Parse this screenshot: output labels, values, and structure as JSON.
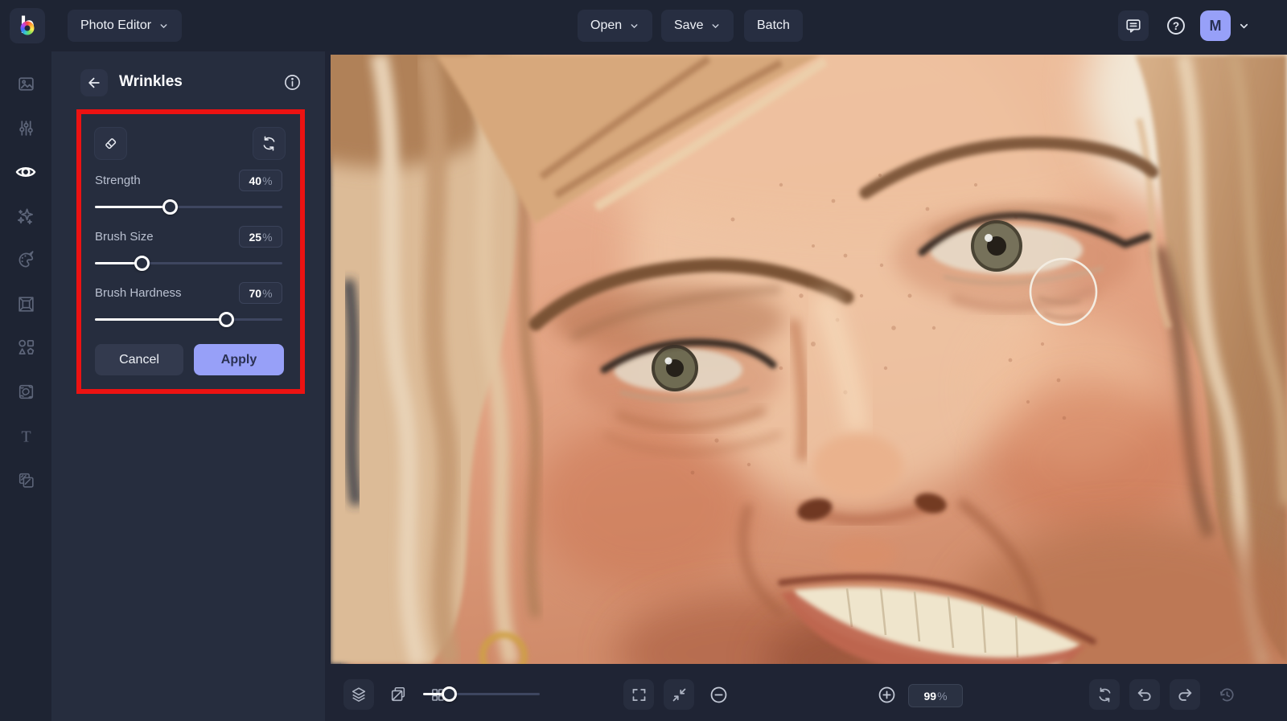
{
  "app": {
    "logo_glyph": "b",
    "title_button": "Photo Editor",
    "topbar": {
      "open": "Open",
      "save": "Save",
      "batch": "Batch",
      "help_glyph": "?",
      "avatar_initial": "M"
    },
    "colors": {
      "accent": "#97a0f8",
      "annotation_red": "#ec1212",
      "topbar_bg": "#1e2433",
      "panel_bg": "#262d3e",
      "canvas_bg": "#1f2434",
      "slider_fill": "#ffffff"
    }
  },
  "sidebar": {
    "active_item": "touch-up",
    "items": [
      {
        "icon": "photo-icon"
      },
      {
        "icon": "adjust-sliders-icon"
      },
      {
        "icon": "touch-up-eye-icon"
      },
      {
        "icon": "effects-sparkles-icon"
      },
      {
        "icon": "artsy-palette-icon"
      },
      {
        "icon": "frames-icon"
      },
      {
        "icon": "graphics-shapes-icon"
      },
      {
        "icon": "textures-icon"
      },
      {
        "icon": "text-tool-icon"
      },
      {
        "icon": "overlays-icon"
      }
    ],
    "text_tool_glyph": "T"
  },
  "panel": {
    "title": "Wrinkles",
    "tools": {
      "eraser": "eraser-tool",
      "reset": "reset-tool"
    },
    "sliders": [
      {
        "label": "Strength",
        "value": 40,
        "display": "40",
        "unit": "%"
      },
      {
        "label": "Brush Size",
        "value": 25,
        "display": "25",
        "unit": "%"
      },
      {
        "label": "Brush Hardness",
        "value": 70,
        "display": "70",
        "unit": "%"
      }
    ],
    "cancel_label": "Cancel",
    "apply_label": "Apply"
  },
  "bottombar": {
    "zoom_display": "99",
    "zoom_unit": "%",
    "zoom_slider_percent": 22
  },
  "canvas_state": {
    "brush_cursor": {
      "visible": true,
      "radius_px": 41
    }
  }
}
